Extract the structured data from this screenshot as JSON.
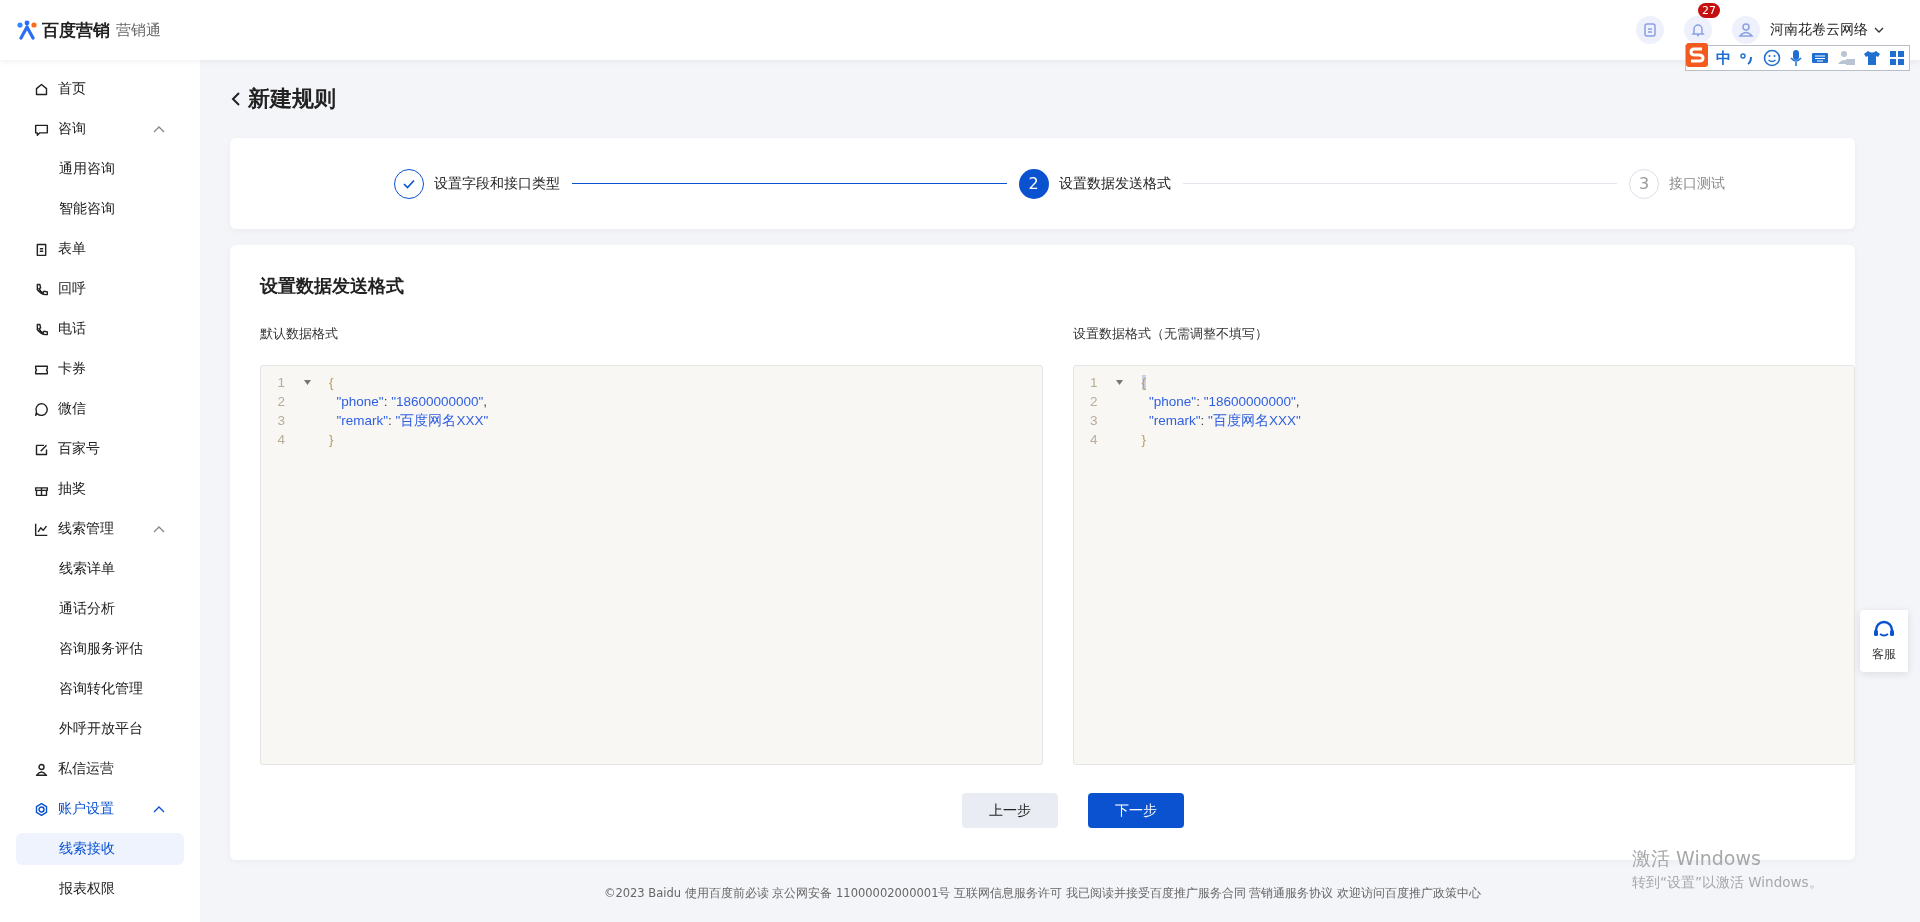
{
  "header": {
    "brand": "百度营销",
    "product": "营销通",
    "notification_count": "27",
    "account": "河南花卷云网络"
  },
  "ime_toolbar": {
    "mode": "中"
  },
  "sidebar": {
    "items": [
      {
        "label": "首页",
        "selected": false
      },
      {
        "label": "咨询",
        "selected": false,
        "expanded": true,
        "children": [
          {
            "label": "通用咨询",
            "selected": false
          },
          {
            "label": "智能咨询",
            "selected": false
          }
        ]
      },
      {
        "label": "表单",
        "selected": false
      },
      {
        "label": "回呼",
        "selected": false
      },
      {
        "label": "电话",
        "selected": false
      },
      {
        "label": "卡券",
        "selected": false
      },
      {
        "label": "微信",
        "selected": false
      },
      {
        "label": "百家号",
        "selected": false
      },
      {
        "label": "抽奖",
        "selected": false
      },
      {
        "label": "线索管理",
        "selected": false,
        "expanded": true,
        "children": [
          {
            "label": "线索详单",
            "selected": false
          },
          {
            "label": "通话分析",
            "selected": false
          },
          {
            "label": "咨询服务评估",
            "selected": false
          },
          {
            "label": "咨询转化管理",
            "selected": false
          },
          {
            "label": "外呼开放平台",
            "selected": false
          }
        ]
      },
      {
        "label": "私信运营",
        "selected": false
      },
      {
        "label": "账户设置",
        "selected": true,
        "expanded": true,
        "children": [
          {
            "label": "线索接收",
            "selected": true
          },
          {
            "label": "报表权限",
            "selected": false
          }
        ]
      }
    ]
  },
  "page_title": "新建规则",
  "steps": [
    {
      "label": "设置字段和接口类型",
      "completed": true,
      "selected": false
    },
    {
      "number": "2",
      "label": "设置数据发送格式",
      "completed": false,
      "selected": true
    },
    {
      "number": "3",
      "label": "接口测试",
      "completed": false,
      "selected": false
    }
  ],
  "section_title": "设置数据发送格式",
  "editors": [
    {
      "label": "默认数据格式",
      "lines": [
        {
          "number": "1",
          "fold": true,
          "tokens": [
            {
              "text": "{",
              "kind": "brace",
              "highlighted": false
            }
          ]
        },
        {
          "number": "2",
          "fold": false,
          "tokens": [
            {
              "text": "  \"phone\"",
              "kind": "key"
            },
            {
              "text": ": ",
              "kind": "punct"
            },
            {
              "text": "\"18600000000\"",
              "kind": "string"
            },
            {
              "text": ",",
              "kind": "punct"
            }
          ]
        },
        {
          "number": "3",
          "fold": false,
          "tokens": [
            {
              "text": "  \"remark\"",
              "kind": "key"
            },
            {
              "text": ": ",
              "kind": "punct"
            },
            {
              "text": "\"百度网名XXX\"",
              "kind": "string"
            }
          ]
        },
        {
          "number": "4",
          "fold": false,
          "tokens": [
            {
              "text": "}",
              "kind": "brace",
              "highlighted": false
            }
          ]
        }
      ]
    },
    {
      "label": "设置数据格式（无需调整不填写）",
      "lines": [
        {
          "number": "1",
          "fold": true,
          "tokens": [
            {
              "text": "{",
              "kind": "brace",
              "highlighted": true
            }
          ]
        },
        {
          "number": "2",
          "fold": false,
          "tokens": [
            {
              "text": "  \"phone\"",
              "kind": "key"
            },
            {
              "text": ": ",
              "kind": "punct"
            },
            {
              "text": "\"18600000000\"",
              "kind": "string"
            },
            {
              "text": ",",
              "kind": "punct"
            }
          ]
        },
        {
          "number": "3",
          "fold": false,
          "tokens": [
            {
              "text": "  \"remark\"",
              "kind": "key"
            },
            {
              "text": ": ",
              "kind": "punct"
            },
            {
              "text": "\"百度网名XXX\"",
              "kind": "string"
            }
          ]
        },
        {
          "number": "4",
          "fold": false,
          "tokens": [
            {
              "text": "}",
              "kind": "brace",
              "highlighted": false
            }
          ]
        }
      ]
    }
  ],
  "buttons": [
    {
      "label": "上一步",
      "kind": "secondary"
    },
    {
      "label": "下一步",
      "kind": "primary"
    }
  ],
  "footer": "©2023  Baidu 使用百度前必读 京公网安备 11000002000001号 互联网信息服务许可 我已阅读并接受百度推广服务合同 营销通服务协议 欢迎访问百度推广政策中心",
  "customer_service": "客服",
  "windows_activation": {
    "title": "激活 Windows",
    "hint": "转到“设置”以激活 Windows。"
  }
}
